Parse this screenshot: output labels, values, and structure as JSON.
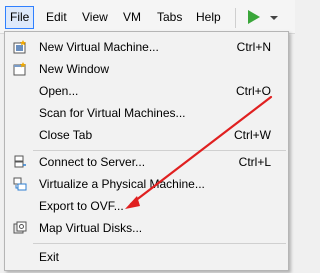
{
  "menubar": {
    "items": [
      "File",
      "Edit",
      "View",
      "VM",
      "Tabs",
      "Help"
    ]
  },
  "file_menu": {
    "items": [
      {
        "label": "New Virtual Machine...",
        "shortcut": "Ctrl+N",
        "icon": "new-vm-icon"
      },
      {
        "label": "New Window",
        "shortcut": "",
        "icon": "new-window-icon"
      },
      {
        "label": "Open...",
        "shortcut": "Ctrl+O",
        "icon": ""
      },
      {
        "label": "Scan for Virtual Machines...",
        "shortcut": "",
        "icon": ""
      },
      {
        "label": "Close Tab",
        "shortcut": "Ctrl+W",
        "icon": ""
      },
      {
        "label": "Connect to Server...",
        "shortcut": "Ctrl+L",
        "icon": "connect-server-icon"
      },
      {
        "label": "Virtualize a Physical Machine...",
        "shortcut": "",
        "icon": "virtualize-icon"
      },
      {
        "label": "Export to OVF...",
        "shortcut": "",
        "icon": ""
      },
      {
        "label": "Map Virtual Disks...",
        "shortcut": "",
        "icon": "map-disks-icon"
      },
      {
        "label": "Exit",
        "shortcut": "",
        "icon": ""
      }
    ]
  },
  "colors": {
    "accent_border": "#2f80ff",
    "active_bg": "#dde9fb",
    "play_green": "#3aa63a",
    "annotation_red": "#e02020"
  }
}
